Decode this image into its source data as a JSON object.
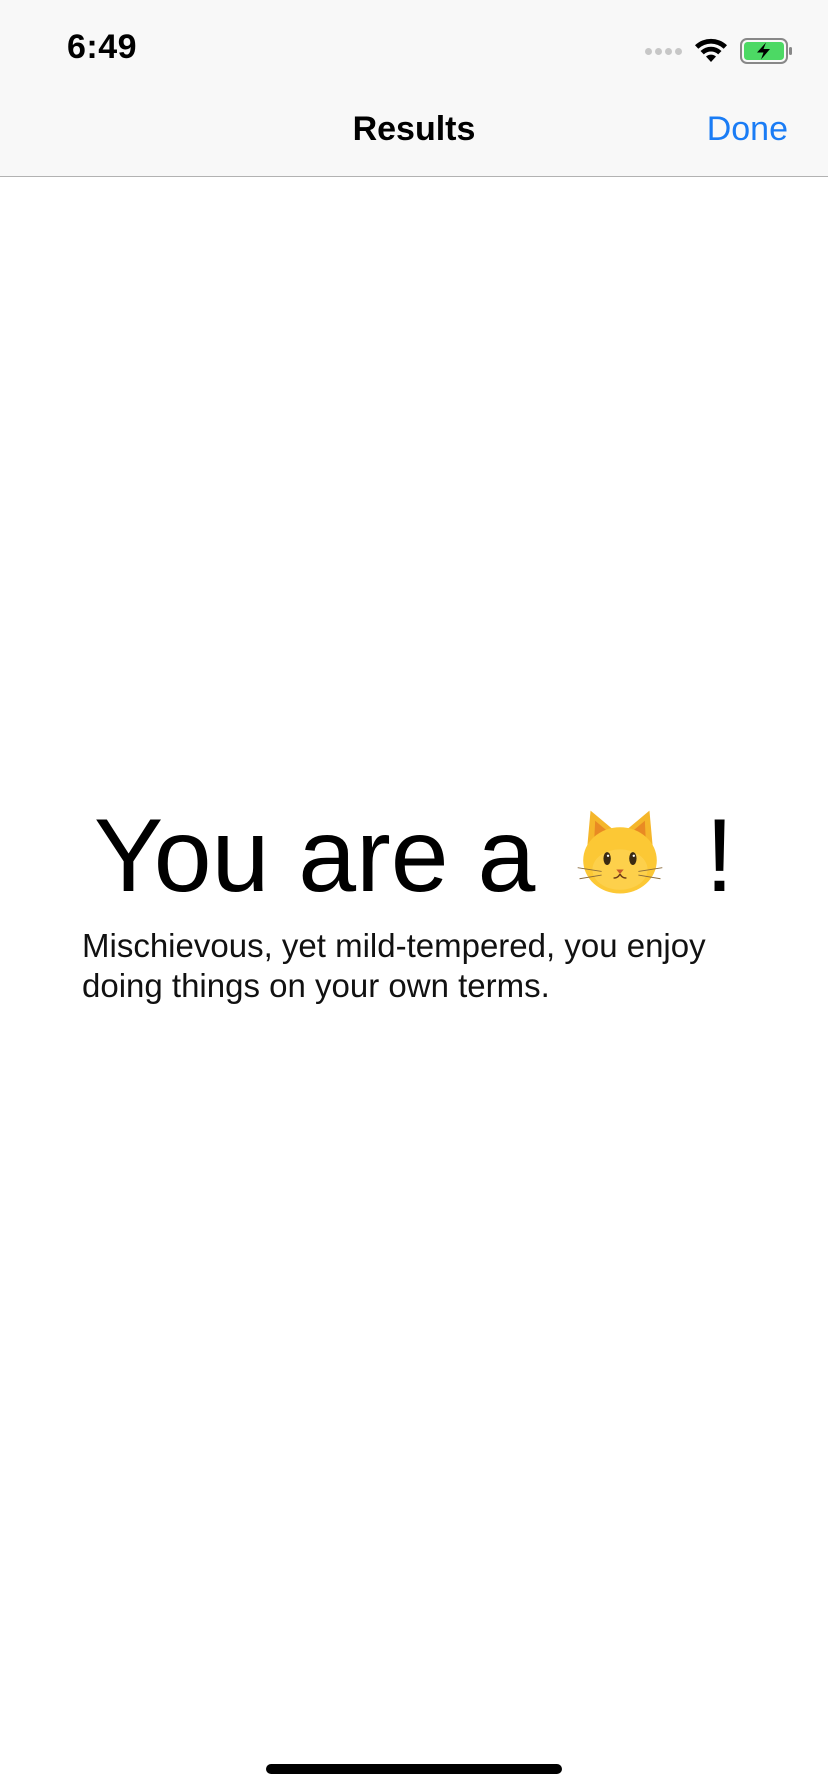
{
  "status_bar": {
    "time": "6:49",
    "icons": [
      "signal-dots-icon",
      "wifi-icon",
      "battery-charging-icon"
    ],
    "battery_color": "#4cd964"
  },
  "nav_bar": {
    "title": "Results",
    "done_label": "Done",
    "accent_color": "#1a7cf5"
  },
  "result": {
    "prefix": "You are a",
    "emoji_icon": "cat-face-icon",
    "suffix": "!",
    "description": "Mischievous, yet mild-tempered, you enjoy doing things on your own terms."
  }
}
